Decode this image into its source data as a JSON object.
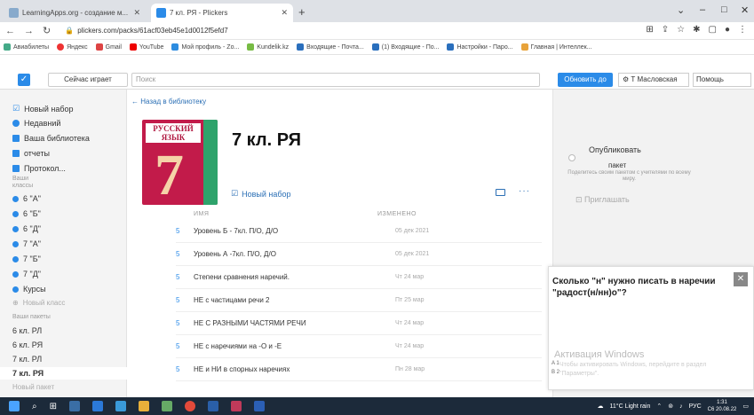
{
  "browser": {
    "tabs": [
      {
        "label": "LearningApps.org - создание м...",
        "active": false
      },
      {
        "label": "7 кл. РЯ - Plickers",
        "active": true
      }
    ],
    "url": "plickers.com/packs/61acf03eb45e1d0012f5efd7",
    "bookmarks": [
      "Авиабилеты",
      "Яндекс",
      "Gmail",
      "YouTube",
      "Мой профиль - Zo...",
      "Kundelik.kz",
      "Входящие - Почта...",
      "(1) Входящие - По...",
      "Настройки - Паро...",
      "Главная | Интеллек..."
    ],
    "window_controls": [
      "⌄",
      "–",
      "□",
      "✕"
    ]
  },
  "header": {
    "now_playing": "Сейчас играет",
    "search_placeholder": "Поиск",
    "upgrade": "Обновить до Про",
    "user": "Т Масловская",
    "help": "Помощь"
  },
  "sidebar": {
    "new_set": "Новый набор",
    "recent": "Недавний",
    "library": "Ваша библиотека",
    "reports": "отчеты",
    "protocol": "Протокол...",
    "your_classes": "Ваши классы",
    "classes": [
      "6 \"А\"",
      "6 \"Б\"",
      "6 \"Д\"",
      "7 \"А\"",
      "7 \"Б\"",
      "7 \"Д\"",
      "Курсы"
    ],
    "new_class": "Новый класс",
    "your_packs": "Ваши пакеты",
    "packs": [
      "6 кл. РЛ",
      "6 кл. РЯ",
      "7 кл. РЛ",
      "7 кл. РЯ"
    ],
    "new_pack": "Новый пакет"
  },
  "main": {
    "back": "← Назад в библиотеку",
    "cover_title": "РУССКИЙ ЯЗЫК",
    "cover_number": "7",
    "title": "7 кл. РЯ",
    "new_set": "Новый набор",
    "col_name": "ИМЯ",
    "col_changed": "ИЗМЕНЕНО",
    "rows": [
      {
        "num": "5",
        "name": "Уровень Б - 7кл. П/О, Д/О",
        "date": "05 дек 2021"
      },
      {
        "num": "5",
        "name": "Уровень А -7кл. П/О, Д/О",
        "date": "05 дек 2021"
      },
      {
        "num": "5",
        "name": "Степени сравнения наречий.",
        "date": "Чт 24 мар"
      },
      {
        "num": "5",
        "name": "НЕ с частицами речи 2",
        "date": "Пт 25 мар"
      },
      {
        "num": "5",
        "name": "НЕ С РАЗНЫМИ ЧАСТЯМИ РЕЧИ",
        "date": "Чт 24 мар"
      },
      {
        "num": "5",
        "name": "НЕ с наречиями на -О и -Е",
        "date": "Чт 24 мар"
      },
      {
        "num": "5",
        "name": "НЕ и НИ в спорных наречиях",
        "date": "Пн 28 мар"
      }
    ]
  },
  "right_panel": {
    "publish": "Опубликовать",
    "package": "пакет",
    "description": "Поделитесь своим пакетом с учителями по всему миру.",
    "invite": "Приглашать"
  },
  "popup": {
    "question": "Сколько \"н\" нужно писать в наречии \"радост(н/нн)о\"?",
    "close": "✕",
    "option_a": "A 1",
    "option_b": "B 2",
    "watermark_title": "Активация Windows",
    "watermark_text": "Чтобы активировать Windows, перейдите в раздел \"Параметры\"."
  },
  "taskbar": {
    "weather": "11°C  Light rain",
    "lang": "РУС",
    "time": "1:31",
    "date": "C6 20.08.22"
  }
}
